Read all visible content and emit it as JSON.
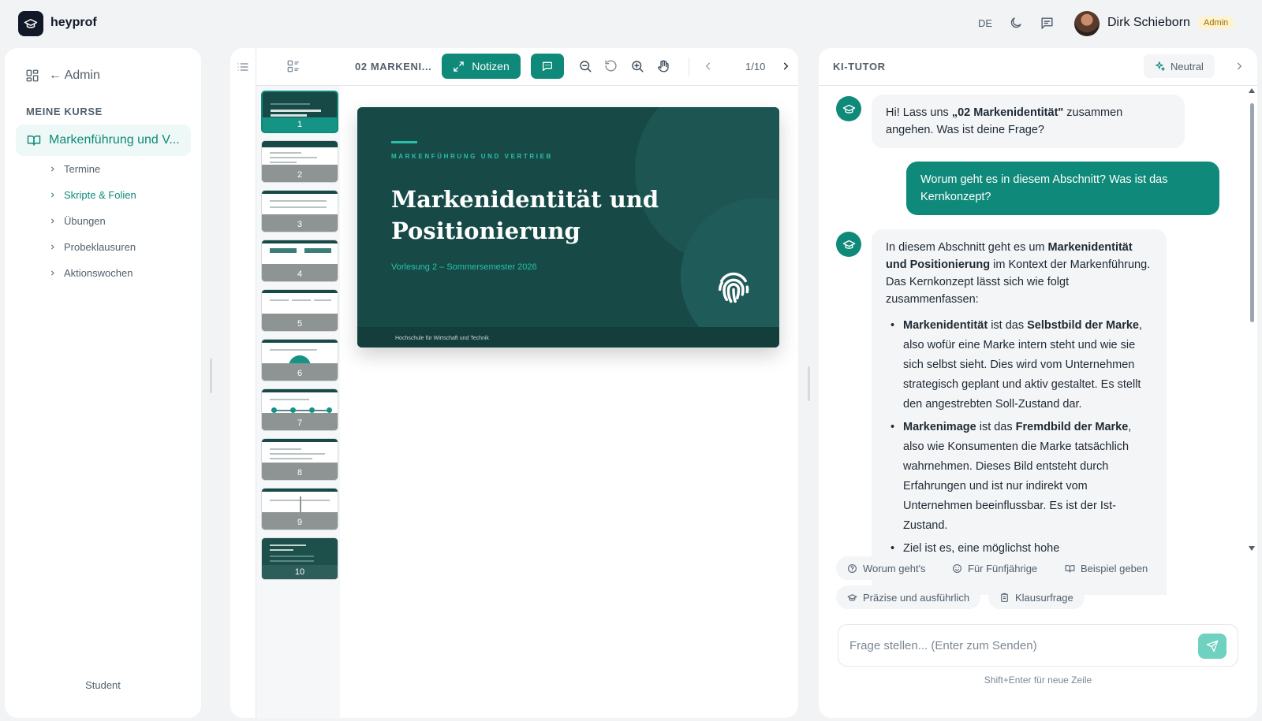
{
  "app": {
    "name": "heyprof"
  },
  "header": {
    "language": "DE",
    "user_name": "Dirk Schieborn",
    "role_badge": "Admin"
  },
  "sidebar": {
    "back_label": "← Admin",
    "section_label": "MEINE KURSE",
    "course_label": "Markenführung und V...",
    "items": [
      {
        "label": "Termine",
        "active": false
      },
      {
        "label": "Skripte & Folien",
        "active": true
      },
      {
        "label": "Übungen",
        "active": false
      },
      {
        "label": "Probeklausuren",
        "active": false
      },
      {
        "label": "Aktionswochen",
        "active": false
      }
    ],
    "footer_role": "Student"
  },
  "viewer": {
    "doc_title": "02 MARKENI...",
    "notes_label": "Notizen",
    "page_indicator": "1/10",
    "thumbnails": [
      "1",
      "2",
      "3",
      "4",
      "5",
      "6",
      "7",
      "8",
      "9",
      "10"
    ],
    "active_page": 1,
    "slide": {
      "overline": "MARKENFÜHRUNG UND VERTRIEB",
      "title": "Markenidentität und Positionierung",
      "subtitle": "Vorlesung 2 – Sommersemester 2026",
      "footer": "Hochschule für Wirtschaft und Technik"
    }
  },
  "tutor": {
    "title": "KI-TUTOR",
    "tone_label": "Neutral",
    "greeting_prefix": "Hi! Lass uns ",
    "greeting_bold": "„02 Markenidentität\"",
    "greeting_suffix": " zusammen angehen. Was ist deine Frage?",
    "user_question": "Worum geht es in diesem Abschnitt? Was ist das Kernkonzept?",
    "answer": {
      "intro_1": "In diesem Abschnitt geht es um ",
      "intro_bold": "Markenidentität und Positionierung",
      "intro_2": " im Kontext der Markenführung. Das Kernkonzept lässt sich wie folgt zusammenfassen:",
      "b1_term": "Markenidentität",
      "b1_mid": " ist das ",
      "b1_bold2": "Selbstbild der Marke",
      "b1_rest": ", also wofür eine Marke intern steht und wie sie sich selbst sieht. Dies wird vom Unternehmen strategisch geplant und aktiv gestaltet. Es stellt den angestrebten Soll-Zustand dar.",
      "b2_term": "Markenimage",
      "b2_mid": " ist das ",
      "b2_bold2": "Fremdbild der Marke",
      "b2_rest": ", also wie Konsumenten die Marke tatsächlich wahrnehmen. Dieses Bild entsteht durch Erfahrungen und ist nur indirekt vom Unternehmen beeinflussbar. Es ist der Ist-Zustand.",
      "b3_start": "Ziel ist es, eine möglichst hohe"
    },
    "chips": [
      {
        "label": "Worum geht's",
        "icon": "help-circle-icon"
      },
      {
        "label": "Für Fünfjährige",
        "icon": "smile-icon"
      },
      {
        "label": "Beispiel geben",
        "icon": "book-open-icon"
      },
      {
        "label": "Präzise und ausführlich",
        "icon": "graduation-cap-icon"
      },
      {
        "label": "Klausurfrage",
        "icon": "clipboard-icon"
      }
    ],
    "input_placeholder": "Frage stellen... (Enter zum Senden)",
    "input_hint": "Shift+Enter für neue Zeile"
  },
  "colors": {
    "accent": "#0f8a7a",
    "slide_bg": "#174a47",
    "slide_accent": "#2bbfa8",
    "badge_bg": "#fdf3d0"
  }
}
